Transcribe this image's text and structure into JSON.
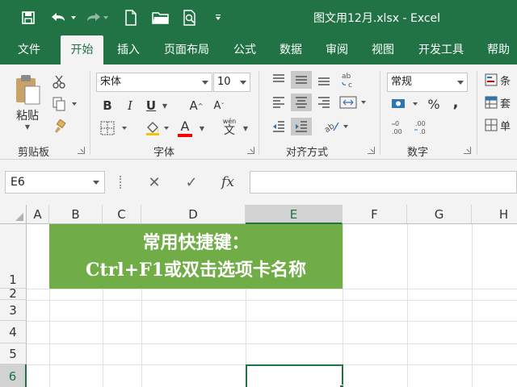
{
  "window": {
    "title": "图文用12月.xlsx  -  Excel",
    "accent_color": "#217346"
  },
  "quick_access": {
    "save_icon": "save-icon",
    "undo_icon": "undo-icon",
    "redo_icon": "redo-icon",
    "new_icon": "new-file-icon",
    "open_icon": "open-folder-icon",
    "preview_icon": "print-preview-icon",
    "customize_icon": "customize-qat-icon"
  },
  "tabs": [
    {
      "label": "文件",
      "active": false
    },
    {
      "label": "开始",
      "active": true
    },
    {
      "label": "插入",
      "active": false
    },
    {
      "label": "页面布局",
      "active": false
    },
    {
      "label": "公式",
      "active": false
    },
    {
      "label": "数据",
      "active": false
    },
    {
      "label": "审阅",
      "active": false
    },
    {
      "label": "视图",
      "active": false
    },
    {
      "label": "开发工具",
      "active": false
    },
    {
      "label": "帮助",
      "active": false
    }
  ],
  "ribbon": {
    "clipboard": {
      "label": "剪贴板",
      "paste_label": "粘贴"
    },
    "font": {
      "label": "字体",
      "font_name": "宋体",
      "font_size": "10",
      "bold": "B",
      "italic": "I",
      "underline": "U",
      "grow": "A",
      "shrink": "A",
      "font_color": "A",
      "font_color_value": "#ff0000",
      "phonetic": "wén"
    },
    "alignment": {
      "label": "对齐方式"
    },
    "number": {
      "label": "数字",
      "format": "常规",
      "percent": "%",
      "comma": ","
    },
    "styles": {
      "items": [
        "条",
        "套",
        "单"
      ]
    }
  },
  "formula_bar": {
    "name_box": "E6",
    "cancel": "✕",
    "enter": "✓",
    "fx": "fx",
    "value": ""
  },
  "sheet": {
    "columns": [
      "A",
      "B",
      "C",
      "D",
      "E",
      "F",
      "G",
      "H"
    ],
    "active_column": "E",
    "rows": [
      "1",
      "2",
      "3",
      "4",
      "5",
      "6"
    ],
    "active_row": "6",
    "banner_line1": "常用快捷键：",
    "banner_line2": "Ctrl+F1或双击选项卡名称",
    "banner_color": "#70ad47",
    "selected_cell": "E6"
  }
}
